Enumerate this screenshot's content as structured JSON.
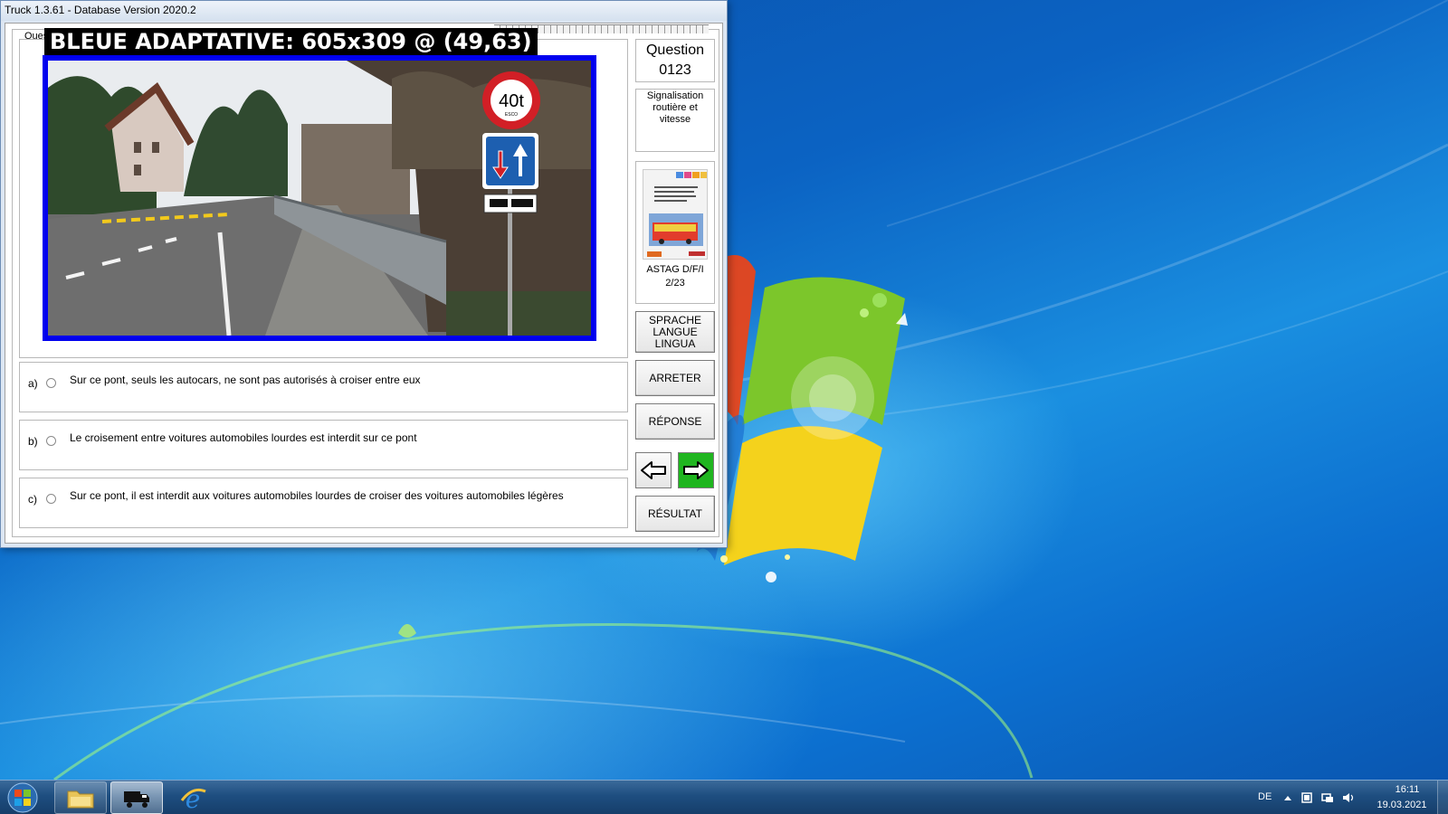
{
  "window": {
    "title": "Truck 1.3.61 - Database Version 2020.2",
    "group_caption": "Questio..."
  },
  "overlay": {
    "text": "BLEUE ADAPTATIVE: 605x309 @ (49,63)"
  },
  "question": {
    "label": "Question",
    "number": "0123",
    "topic": "Signalisation routière et vitesse",
    "book_label_line1": "ASTAG D/F/I",
    "book_label_line2": "2/23"
  },
  "photo": {
    "sign_speed": "40t",
    "sign_speed_sub": "ESCO"
  },
  "answers": [
    {
      "letter": "a)",
      "text": "Sur ce pont, seuls les autocars, ne sont pas autorisés à croiser entre eux"
    },
    {
      "letter": "b)",
      "text": "Le croisement entre voitures automobiles lourdes est interdit sur ce pont"
    },
    {
      "letter": "c)",
      "text": "Sur ce pont, il est interdit aux voitures automobiles lourdes de croiser des voitures automobiles légères"
    }
  ],
  "buttons": {
    "language_line1": "SPRACHE",
    "language_line2": "LANGUE",
    "language_line3": "LINGUA",
    "stop": "ARRETER",
    "answer": "RÉPONSE",
    "result": "RÉSULTAT"
  },
  "taskbar": {
    "language": "DE",
    "time": "16:11",
    "date": "19.03.2021"
  },
  "colors": {
    "photo_frame": "#0000ee",
    "next_button": "#1fb51f"
  }
}
